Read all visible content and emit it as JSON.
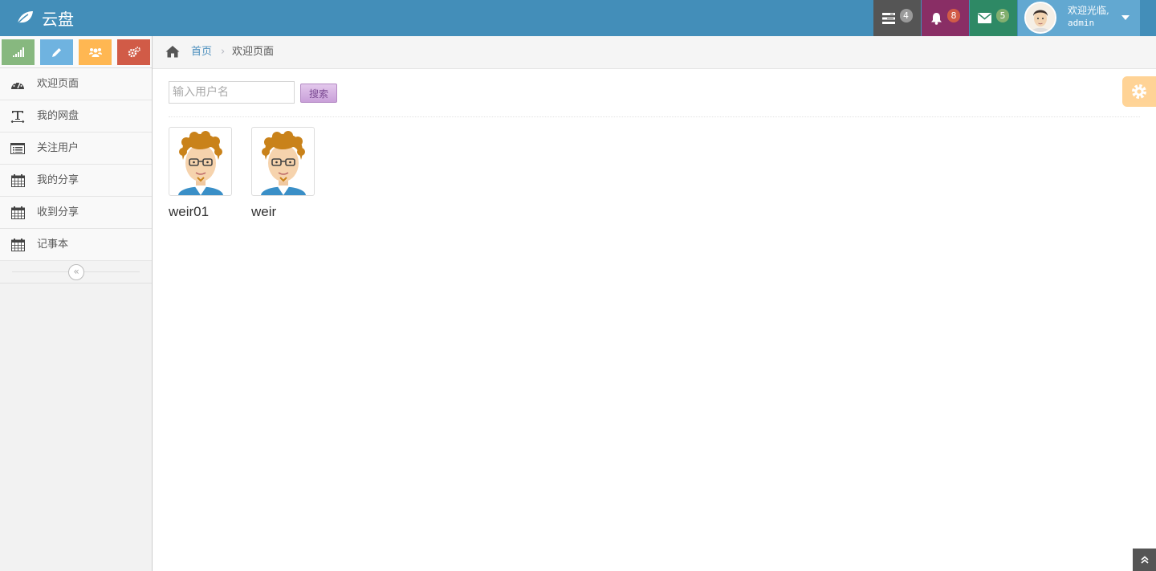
{
  "brand": {
    "title": "云盘",
    "icon": "leaf-icon"
  },
  "navbar": {
    "tasks": {
      "icon": "tasks-icon",
      "count": "4",
      "bg": "#555555",
      "badge": "#9a9a9a"
    },
    "notifications": {
      "icon": "bell-icon",
      "count": "8",
      "bg": "#892e65",
      "badge": "#d15b47"
    },
    "messages": {
      "icon": "envelope-icon",
      "count": "5",
      "bg": "#2e8965",
      "badge": "#82af6f"
    },
    "user": {
      "greeting": "欢迎光临,",
      "name": "admin"
    }
  },
  "shortcuts": [
    {
      "icon": "signal-icon",
      "color": "#87b87f"
    },
    {
      "icon": "pencil-icon",
      "color": "#6fb3e0"
    },
    {
      "icon": "group-icon",
      "color": "#ffb752"
    },
    {
      "icon": "cogs-icon",
      "color": "#d15b47"
    }
  ],
  "sidebar": {
    "items": [
      {
        "label": "欢迎页面",
        "icon": "dashboard-icon"
      },
      {
        "label": "我的网盘",
        "icon": "text-width-icon"
      },
      {
        "label": "关注用户",
        "icon": "list-alt-icon"
      },
      {
        "label": "我的分享",
        "icon": "calendar-icon"
      },
      {
        "label": "收到分享",
        "icon": "calendar-icon"
      },
      {
        "label": "记事本",
        "icon": "calendar-icon"
      }
    ],
    "collapse_label": "«"
  },
  "breadcrumb": {
    "home": "首页",
    "separator": "›",
    "current": "欢迎页面"
  },
  "search": {
    "placeholder": "输入用户名",
    "button": "搜索"
  },
  "users": [
    {
      "name": "weir01"
    },
    {
      "name": "weir"
    }
  ]
}
